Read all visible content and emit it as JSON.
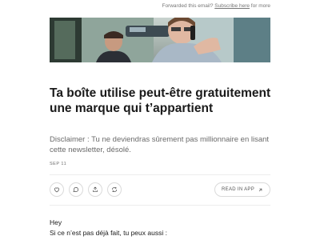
{
  "header": {
    "forwarded_prefix": "Forwarded this email?",
    "subscribe_link": "Subscribe here",
    "forwarded_suffix": "for more"
  },
  "post": {
    "title": "Ta boîte utilise peut-être gratuitement une marque qui t’appartient",
    "subtitle": "Disclaimer : Tu ne deviendras sûrement pas millionnaire en lisant cette newsletter, désolé.",
    "date": "SEP 11"
  },
  "actions": {
    "like_icon": "heart-icon",
    "comment_icon": "comment-icon",
    "share_icon": "share-icon",
    "restack_icon": "restack-icon",
    "read_in_app_label": "READ IN APP",
    "read_in_app_icon": "arrow-up-right-icon"
  },
  "body": {
    "greeting": "Hey",
    "line1": "Si ce n’est pas déjà fait, tu peux aussi :"
  }
}
